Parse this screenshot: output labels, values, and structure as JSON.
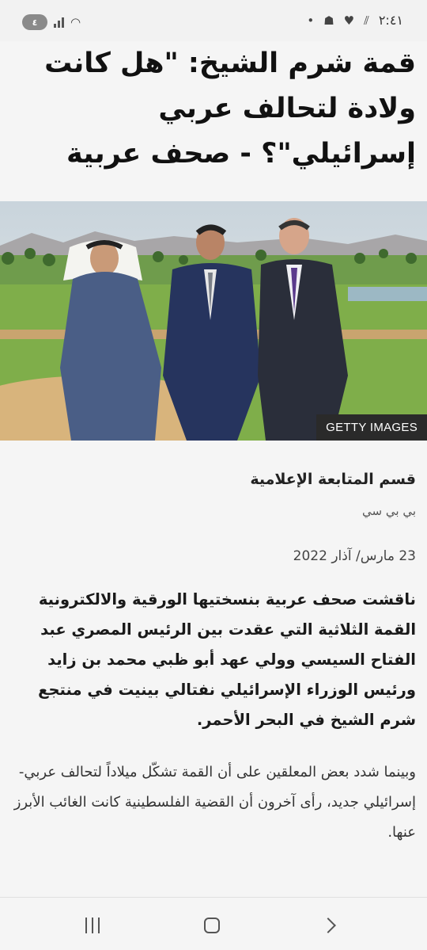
{
  "status_bar": {
    "time": "٢:٤١",
    "battery_level": "٤"
  },
  "article": {
    "headline": "قمة شرم الشيخ: \"هل كانت ولادة لتحالف عربي إسرائيلي\"؟ - صحف عربية",
    "image_credit": "GETTY IMAGES",
    "byline": "قسم المتابعة الإعلامية",
    "source": "بي بي سي",
    "date": "23 مارس/ آذار 2022",
    "lead": "ناقشت صحف عربية بنسختيها الورقية والالكترونية القمة الثلاثية التي عقدت بين الرئيس المصري عبد الفتاح السيسي وولي عهد أبو ظبي محمد بن زايد ورئيس الوزراء الإسرائيلي نفتالي بينيت في منتجع شرم الشيخ في البحر الأحمر.",
    "paragraph": "وبينما شدد بعض المعلقين على أن القمة تشكّل ميلاداً لتحالف عربي-إسرائيلي جديد، رأى آخرون أن القضية الفلسطينية كانت الغائب الأبرز عنها."
  },
  "nav_bar": {
    "icons": [
      "recent-apps-icon",
      "home-icon",
      "back-icon"
    ]
  }
}
